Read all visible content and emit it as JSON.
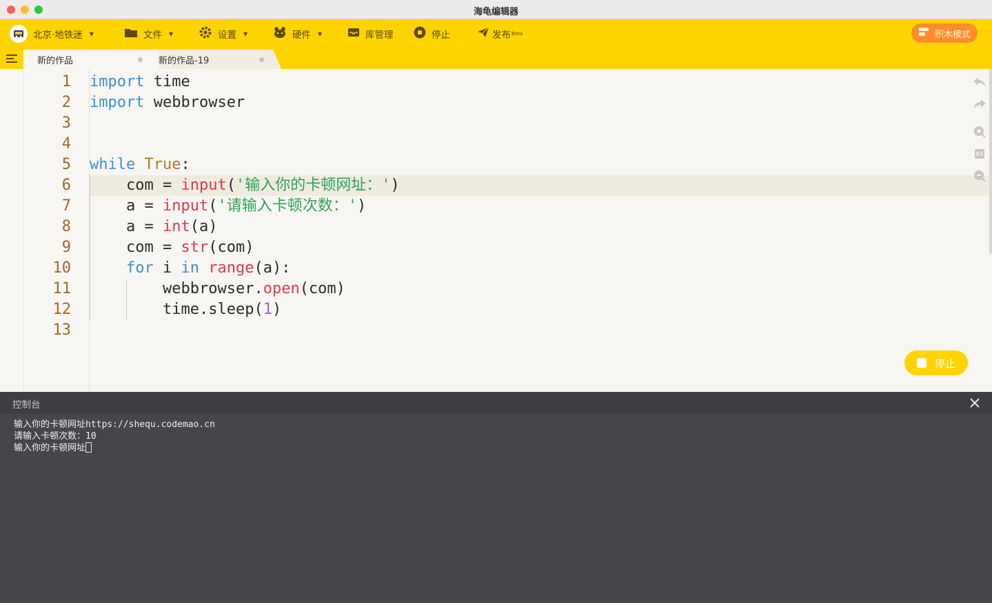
{
  "window": {
    "title": "海龟编辑器"
  },
  "toolbar": {
    "user": "北京·地铁迷",
    "file": "文件",
    "settings": "设置",
    "hardware": "硬件",
    "library": "库管理",
    "stop": "停止",
    "publish": "发布",
    "publish_badge": "Beta",
    "mode": "积木模式"
  },
  "tabs": [
    {
      "label": "新的作品"
    },
    {
      "label": "新的作品-19"
    }
  ],
  "editor": {
    "line_numbers": [
      "1",
      "2",
      "3",
      "4",
      "5",
      "6",
      "7",
      "8",
      "9",
      "10",
      "11",
      "12",
      "13"
    ],
    "code": {
      "l1": {
        "kw": "import",
        "rest": " time"
      },
      "l2": {
        "kw": "import",
        "rest": " webbrowser"
      },
      "l5": {
        "kw": "while",
        "const": "True",
        "colon": ":"
      },
      "l6": {
        "a": "com = ",
        "fn": "input",
        "b": "(",
        "st": "'输入你的卡顿网址：'",
        "c": ")"
      },
      "l7": {
        "a": "a = ",
        "fn": "input",
        "b": "(",
        "st": "'请输入卡顿次数：'",
        "c": ")"
      },
      "l8": {
        "a": "a = ",
        "fn": "int",
        "b": "(a)"
      },
      "l9": {
        "a": "com = ",
        "fn": "str",
        "b": "(com)"
      },
      "l10": {
        "kw1": "for",
        "a": " i ",
        "kw2": "in",
        "sp": " ",
        "fn": "range",
        "b": "(a):"
      },
      "l11": {
        "a": "webbrowser.",
        "fn": "open",
        "b": "(com)"
      },
      "l12": {
        "a": "time.sleep(",
        "num": "1",
        "b": ")"
      }
    },
    "run_stop_label": "停止"
  },
  "console": {
    "title": "控制台",
    "lines": [
      "输入你的卡顿网址https://shequ.codemao.cn",
      "请输入卡顿次数：10",
      "输入你的卡顿网址"
    ]
  },
  "colors": {
    "toolbar_yellow": "#ffd400",
    "mode_orange": "#ff8c2b",
    "keyword_blue": "#3d8fd1",
    "builtin_red": "#e0394b",
    "string_green": "#2fa35a",
    "number_purple": "#a060d0",
    "console_bg": "#44464a"
  }
}
